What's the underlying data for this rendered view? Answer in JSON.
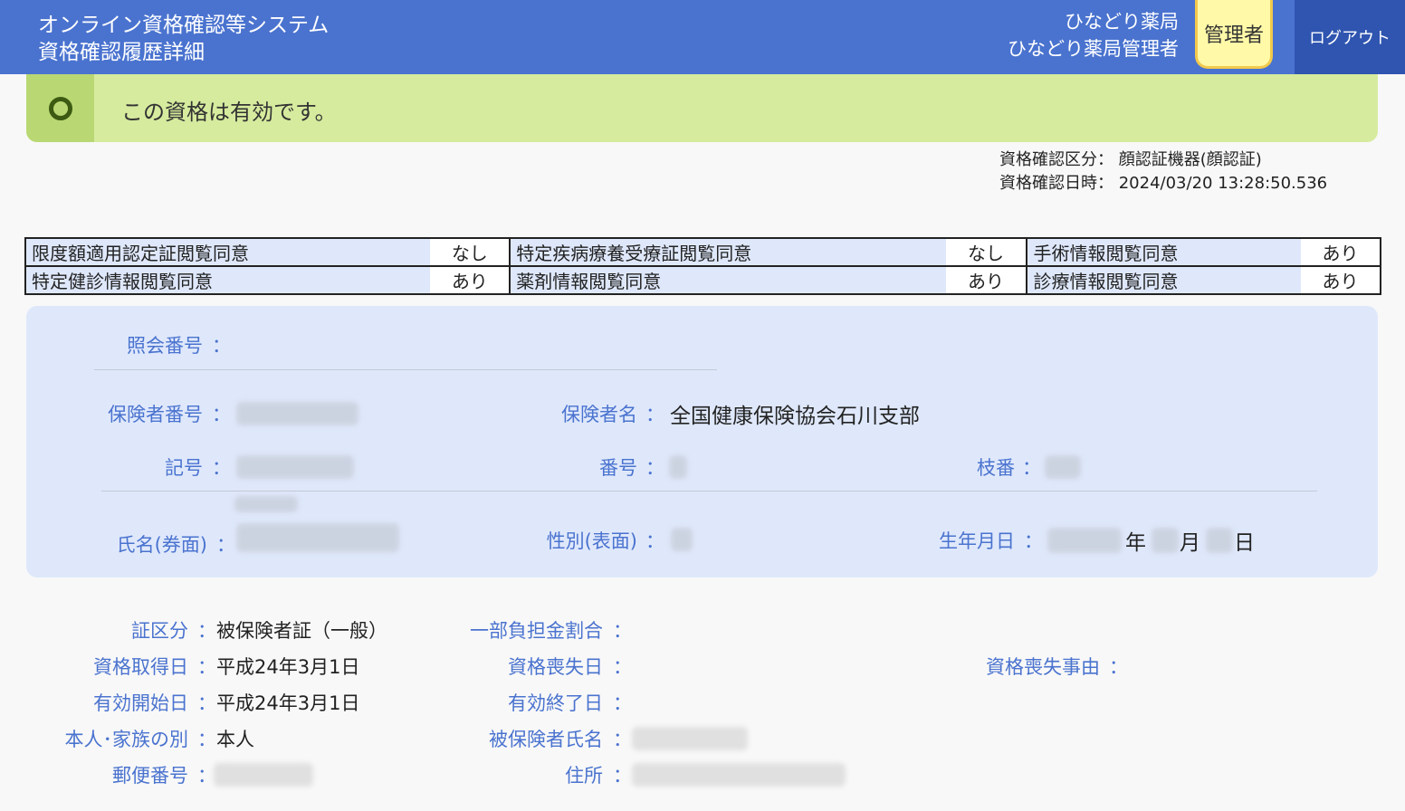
{
  "header": {
    "system_name": "オンライン資格確認等システム",
    "page_name": "資格確認履歴詳細",
    "pharmacy_name": "ひなどり薬局",
    "user_name": "ひなどり薬局管理者",
    "role_badge": "管理者",
    "logout_label": "ログアウト",
    "bg_color": "#4a73cf"
  },
  "status": {
    "icon": "circle-icon",
    "message": "この資格は有効です。",
    "color": "#d6eb9e"
  },
  "meta": {
    "category_label": "資格確認区分：",
    "category_value": "顔認証機器(顔認証)",
    "datetime_label": "資格確認日時：",
    "datetime_value": "2024/03/20 13:28:50.536"
  },
  "consents": [
    [
      {
        "label": "限度額適用認定証閲覧同意",
        "value": "なし"
      },
      {
        "label": "特定疾病療養受療証閲覧同意",
        "value": "なし"
      },
      {
        "label": "手術情報閲覧同意",
        "value": "あり"
      }
    ],
    [
      {
        "label": "特定健診情報閲覧同意",
        "value": "あり"
      },
      {
        "label": "薬剤情報閲覧同意",
        "value": "あり"
      },
      {
        "label": "診療情報閲覧同意",
        "value": "あり"
      }
    ]
  ],
  "card": {
    "inquiry_no_label": "照会番号",
    "insurer_no_label": "保険者番号",
    "insurer_name_label": "保険者名",
    "insurer_name_value": "全国健康保険協会石川支部",
    "symbol_label": "記号",
    "number_label": "番号",
    "branch_label": "枝番",
    "name_label": "氏名(券面)",
    "gender_label": "性別(表面)",
    "birth_label": "生年月日",
    "year_unit": "年",
    "month_unit": "月",
    "day_unit": "日",
    "colon": "："
  },
  "details": {
    "cert_type_label": "証区分",
    "cert_type_value": "被保険者証（一般）",
    "copay_label": "一部負担金割合",
    "acquired_label": "資格取得日",
    "acquired_value": "平成24年3月1日",
    "lost_label": "資格喪失日",
    "lost_reason_label": "資格喪失事由",
    "valid_start_label": "有効開始日",
    "valid_start_value": "平成24年3月1日",
    "valid_end_label": "有効終了日",
    "relation_label": "本人･家族の別",
    "relation_value": "本人",
    "insured_name_label": "被保険者氏名",
    "postal_label": "郵便番号",
    "address_label": "住所"
  }
}
